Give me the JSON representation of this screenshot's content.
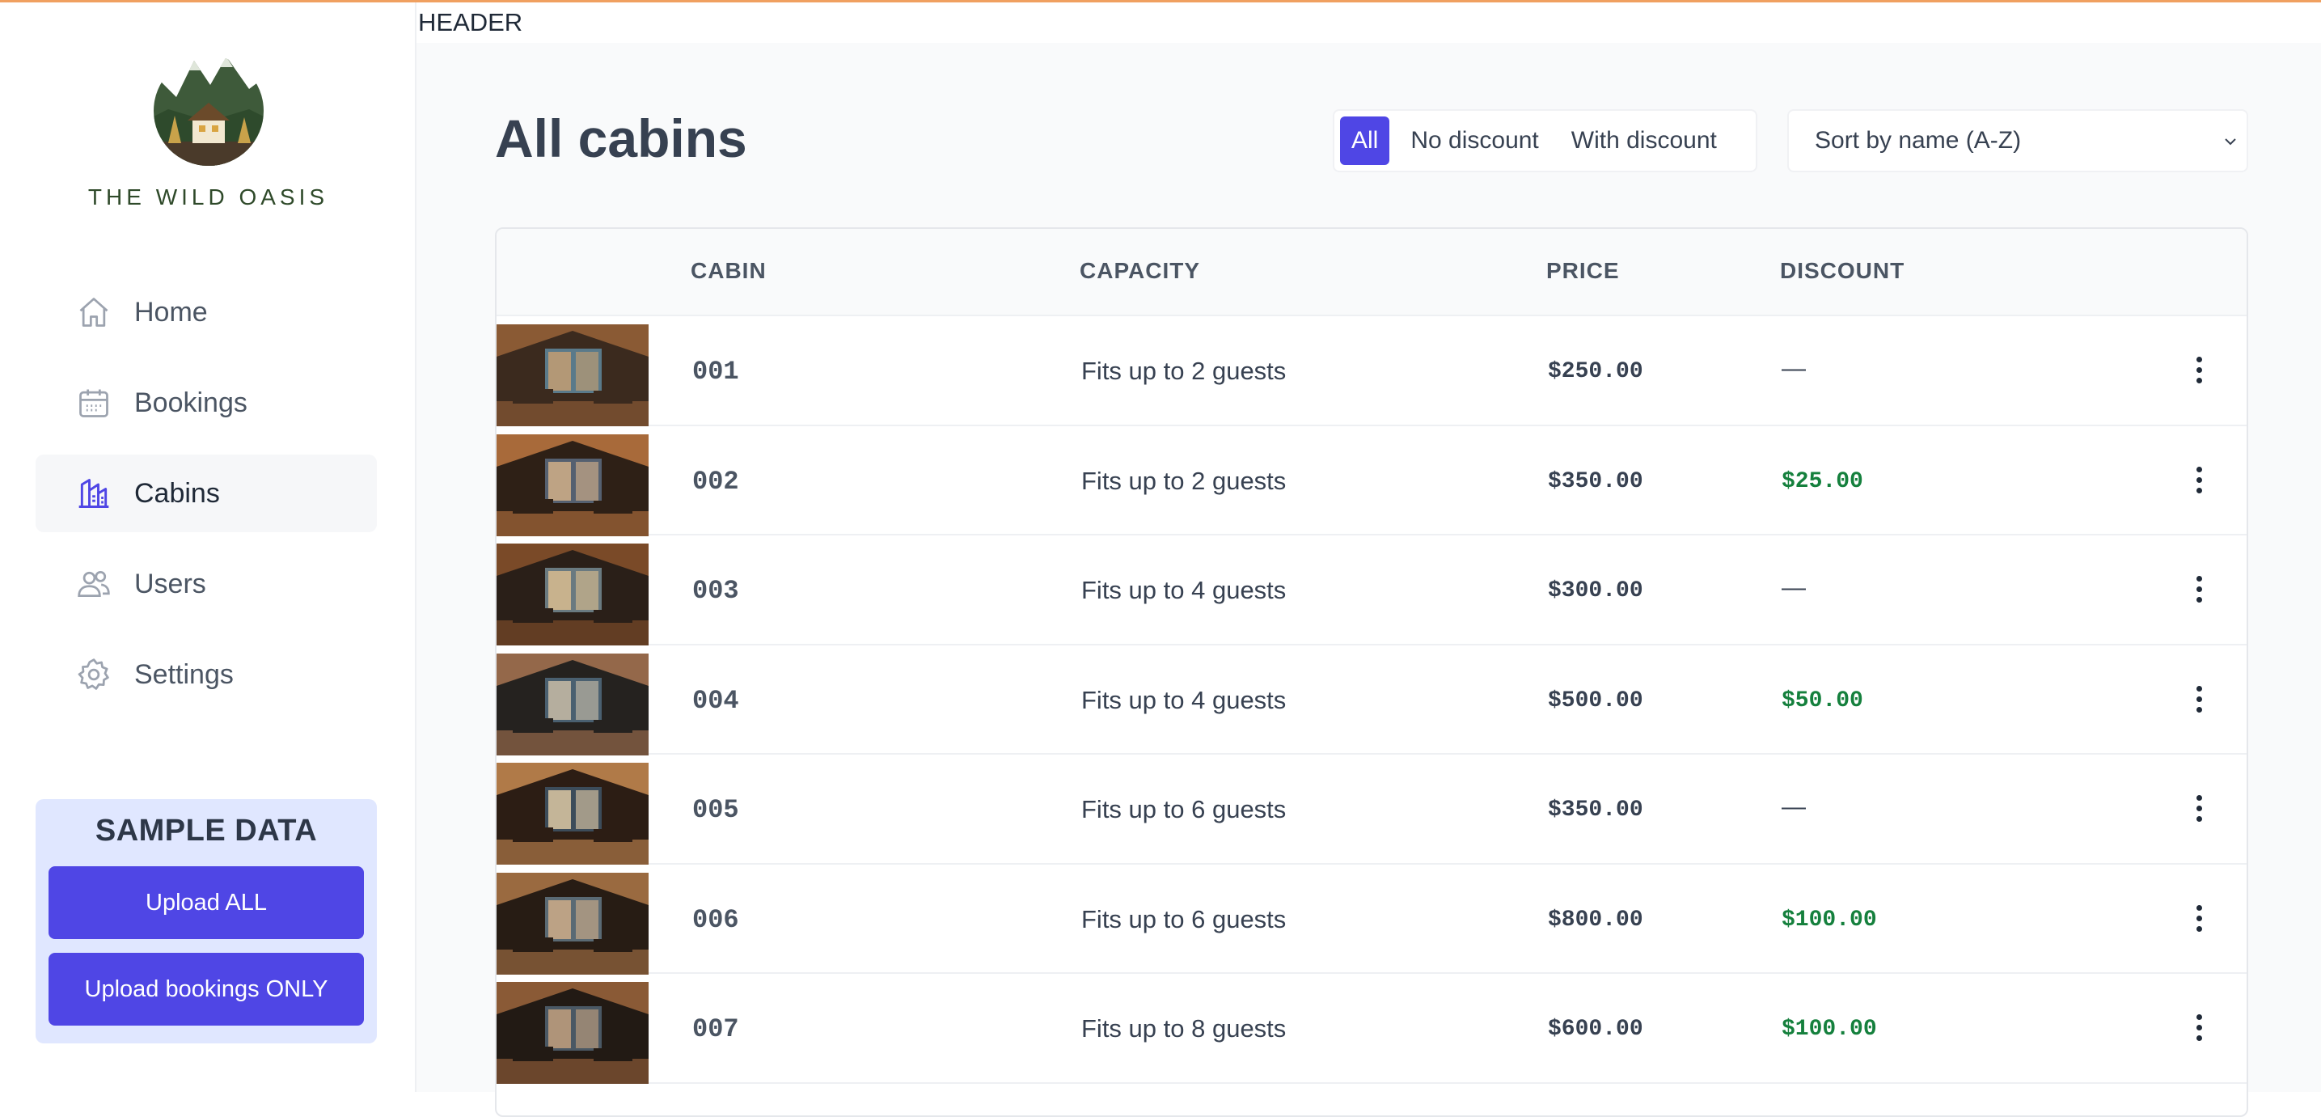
{
  "brand": {
    "name": "THE WILD OASIS"
  },
  "header": {
    "label": "HEADER"
  },
  "sidebar": {
    "items": [
      {
        "label": "Home",
        "icon": "home-icon",
        "active": false
      },
      {
        "label": "Bookings",
        "icon": "calendar-icon",
        "active": false
      },
      {
        "label": "Cabins",
        "icon": "cabins-icon",
        "active": true
      },
      {
        "label": "Users",
        "icon": "users-icon",
        "active": false
      },
      {
        "label": "Settings",
        "icon": "settings-icon",
        "active": false
      }
    ],
    "sample": {
      "title": "SAMPLE DATA",
      "upload_all": "Upload ALL",
      "upload_bookings": "Upload bookings ONLY"
    }
  },
  "main": {
    "title": "All cabins",
    "filters": [
      {
        "label": "All",
        "active": true
      },
      {
        "label": "No discount",
        "active": false
      },
      {
        "label": "With discount",
        "active": false
      }
    ],
    "sort": {
      "selected": "Sort by name (A-Z)"
    },
    "table": {
      "headers": [
        "CABIN",
        "CAPACITY",
        "PRICE",
        "DISCOUNT"
      ],
      "rows": [
        {
          "name": "001",
          "capacity": "Fits up to 2 guests",
          "price": "$250.00",
          "discount": "—"
        },
        {
          "name": "002",
          "capacity": "Fits up to 2 guests",
          "price": "$350.00",
          "discount": "$25.00"
        },
        {
          "name": "003",
          "capacity": "Fits up to 4 guests",
          "price": "$300.00",
          "discount": "—"
        },
        {
          "name": "004",
          "capacity": "Fits up to 4 guests",
          "price": "$500.00",
          "discount": "$50.00"
        },
        {
          "name": "005",
          "capacity": "Fits up to 6 guests",
          "price": "$350.00",
          "discount": "—"
        },
        {
          "name": "006",
          "capacity": "Fits up to 6 guests",
          "price": "$800.00",
          "discount": "$100.00"
        },
        {
          "name": "007",
          "capacity": "Fits up to 8 guests",
          "price": "$600.00",
          "discount": "$100.00"
        }
      ]
    }
  },
  "colors": {
    "accent": "#4f46e5",
    "discount_green": "#15803d",
    "sample_bg": "#e0e7ff"
  }
}
